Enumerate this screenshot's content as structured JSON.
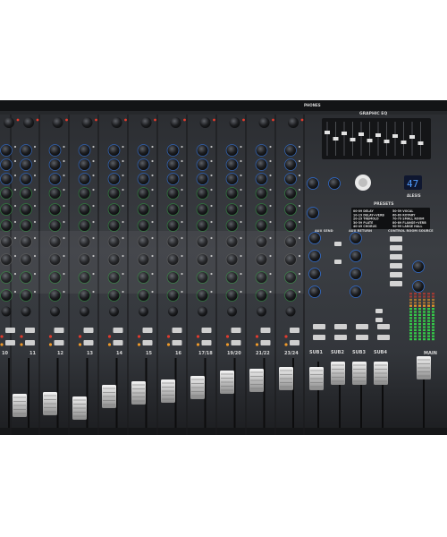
{
  "top_labels": {
    "graphic_eq": "GRAPHIC EQ",
    "phones": "PHONES"
  },
  "channel_numbers": [
    "10",
    "11",
    "12",
    "13",
    "14",
    "15",
    "16",
    "17/18",
    "19/20",
    "21/22",
    "23/24"
  ],
  "subgroup_labels": [
    "SUB1",
    "SUB2",
    "SUB3",
    "SUB4"
  ],
  "main_label": "MAIN",
  "section_labels": {
    "aux_send": "AUX SEND",
    "aux_return": "AUX RETURN",
    "control_room_source": "CONTROL ROOM SOURCE",
    "presets": "PRESETS"
  },
  "fx_display": {
    "value": "47",
    "brand": "ALESIS"
  },
  "preset_list": [
    "00-09 DELAY",
    "10-19 DELAY+VERB",
    "20-29 TREMOLO",
    "30-39 PLATE",
    "40-49 CHORUS",
    "50-59 VOCAL",
    "60-69 ROTARY",
    "70-79 SMALL ROOM",
    "80-89 FLANGE+VERB",
    "90-99 LARGE HALL"
  ],
  "colors": {
    "panel": "#3a3d42",
    "panel_dark": "#1b1c1f",
    "silk": "#d8d8d8",
    "accent_blue": "#2f6fd6",
    "led_green": "#36d14a",
    "led_red": "#e23b2e",
    "led_orange": "#f09a2a"
  }
}
